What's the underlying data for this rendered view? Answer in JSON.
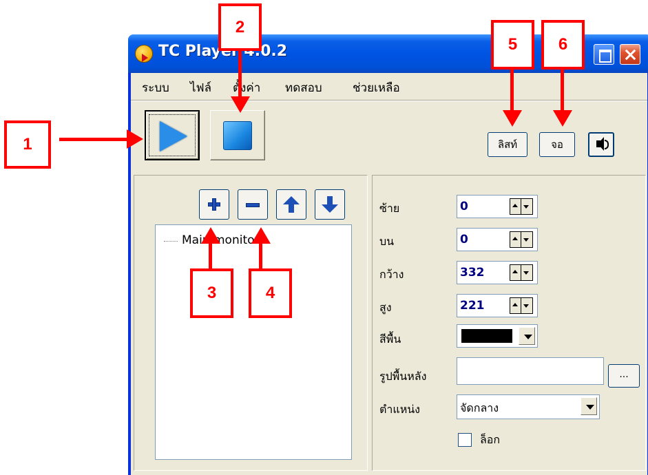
{
  "window": {
    "title": "TC Player 4.0.2",
    "icon_text": "TC",
    "buttons": [
      "maximize",
      "close"
    ]
  },
  "menu": {
    "items": [
      "ระบบ",
      "ไฟล์",
      "ตั้งค่า",
      "ทดสอบ",
      "ช่วยเหลือ"
    ]
  },
  "toolbar": {
    "play_icon": "play-icon",
    "stop_icon": "stop-icon",
    "list_label": "ลิสท์",
    "screen_label": "จอ",
    "sound_icon": "speaker-icon"
  },
  "tree_panel": {
    "tools": [
      "add-icon",
      "remove-icon",
      "move-up-icon",
      "move-down-icon"
    ],
    "items": [
      "Main monitor"
    ]
  },
  "properties": {
    "left_label": "ซ้าย",
    "left_value": "0",
    "top_label": "บน",
    "top_value": "0",
    "width_label": "กว้าง",
    "width_value": "332",
    "height_label": "สูง",
    "height_value": "221",
    "bg_color_label": "สีพื้น",
    "bg_color_value": "#000000",
    "bg_image_label": "รูปพื้นหลัง",
    "bg_image_value": "",
    "browse_label": "...",
    "position_label": "ตำแหน่ง",
    "position_value": "จัดกลาง",
    "lock_label": "ล็อก",
    "lock_checked": false
  },
  "annotations": [
    "1",
    "2",
    "3",
    "4",
    "5",
    "6"
  ],
  "colors": {
    "annotation": "#ff0000",
    "titlebar": "#0054e3",
    "window_bg": "#ece9d8"
  }
}
